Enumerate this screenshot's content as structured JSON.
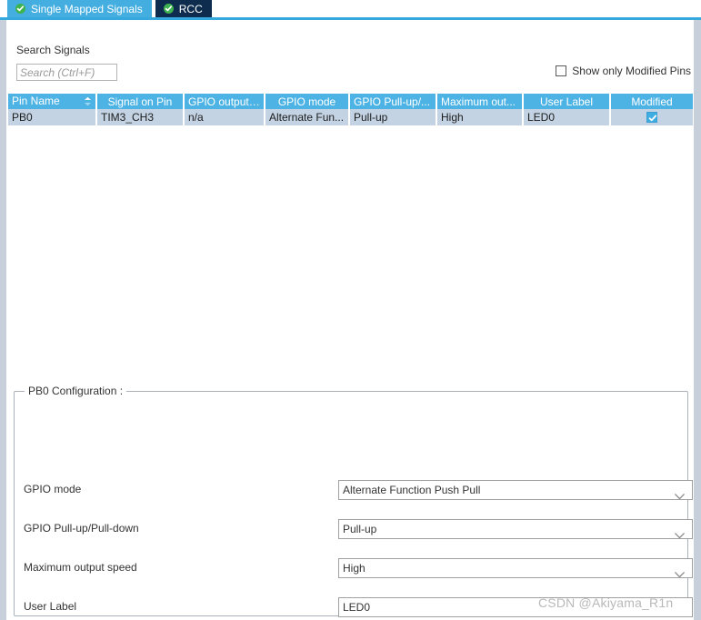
{
  "tabs": [
    {
      "label": "Single Mapped Signals",
      "icon": "check-circle-icon",
      "active": true
    },
    {
      "label": "RCC",
      "icon": "check-circle-icon",
      "active": false
    }
  ],
  "search": {
    "label": "Search Signals",
    "placeholder": "Search (Ctrl+F)",
    "value": ""
  },
  "filter": {
    "show_only_modified_label": "Show only Modified Pins",
    "checked": false
  },
  "table": {
    "columns": [
      "Pin Name",
      "Signal on Pin",
      "GPIO output l...",
      "GPIO mode",
      "GPIO Pull-up/...",
      "Maximum out...",
      "User Label",
      "Modified"
    ],
    "sorted_column": "Pin Name",
    "rows": [
      {
        "pin_name": "PB0",
        "signal_on_pin": "TIM3_CH3",
        "gpio_output_level": "n/a",
        "gpio_mode": "Alternate Fun...",
        "gpio_pull": "Pull-up",
        "max_output_speed": "High",
        "user_label": "LED0",
        "modified": true
      }
    ]
  },
  "config": {
    "legend": "PB0 Configuration :",
    "fields": [
      {
        "label": "GPIO mode",
        "value": "Alternate Function Push Pull",
        "type": "select"
      },
      {
        "label": "GPIO Pull-up/Pull-down",
        "value": "Pull-up",
        "type": "select"
      },
      {
        "label": "Maximum output speed",
        "value": "High",
        "type": "select"
      },
      {
        "label": "User Label",
        "value": "LED0",
        "type": "text"
      }
    ]
  },
  "watermark": "CSDN @Akiyama_R1n",
  "colors": {
    "tab_active_bg": "#44aee0",
    "tab_inactive_bg": "#0d2c4e",
    "accent_underline": "#35a8dd",
    "table_header_bg": "#4db3e4",
    "row_selected_bg": "#c3d3e3",
    "check_badge_green": "#3fb34f",
    "edge_strip": "#c7d0da"
  }
}
